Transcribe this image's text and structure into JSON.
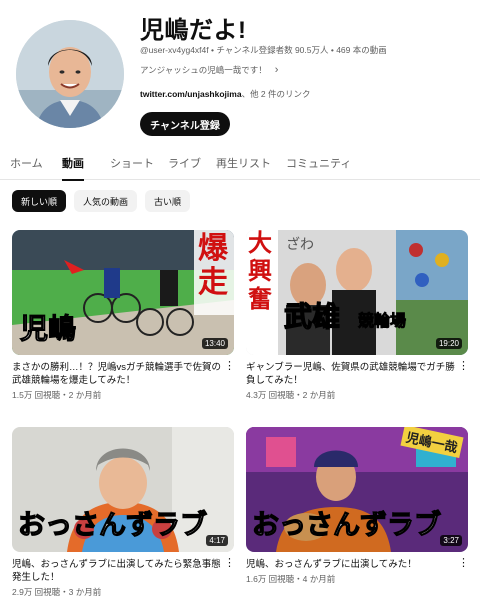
{
  "channel": {
    "name": "児嶋だよ!",
    "handle": "@user-xv4yg4xf4f",
    "subscribers": "チャンネル登録者数 90.5万人",
    "video_count": "469 本の動画",
    "description": "アンジャッシュの児嶋一哉です！",
    "link_primary": "twitter.com/unjashkojima",
    "link_more": "、他 2 件のリンク",
    "subscribe_label": "チャンネル登録"
  },
  "tabs": [
    "ホーム",
    "動画",
    "ショート",
    "ライブ",
    "再生リスト",
    "コミュニティ"
  ],
  "active_tab": "動画",
  "chips": [
    "新しい順",
    "人気の動画",
    "古い順"
  ],
  "videos": [
    {
      "title": "まさかの勝利…！？児嶋vsガチ競輪選手で佐賀の武雄競輪場を爆走してみた！",
      "stats": "1.5万 回視聴・2 か月前",
      "duration": "13:40",
      "thumb_text_1": "爆",
      "thumb_text_2": "走",
      "thumb_text_3": "児嶋"
    },
    {
      "title": "ギャンブラー児嶋、佐賀県の武雄競輪場でガチ勝負してみた！",
      "stats": "4.3万 回視聴・2 か月前",
      "duration": "19:20",
      "thumb_text_1": "大",
      "thumb_text_2": "興",
      "thumb_text_3": "奮",
      "thumb_text_4": "ざわ",
      "thumb_text_5": "武雄",
      "thumb_text_6": "競輪場"
    },
    {
      "title": "児嶋、おっさんずラブに出演してみたら緊急事態発生した！",
      "stats": "2.9万 回視聴・3 か月前",
      "duration": "4:17",
      "thumb_text_1": "おっさんずラブ"
    },
    {
      "title": "児嶋、おっさんずラブに出演してみた！",
      "stats": "1.6万 回視聴・4 か月前",
      "duration": "3:27",
      "thumb_text_1": "おっさんずラブ",
      "thumb_text_2": "児嶋一哉"
    }
  ],
  "colors": {
    "accent": "#0f0f0f",
    "secondary_text": "#606060",
    "chip_bg": "#f2f2f2"
  }
}
